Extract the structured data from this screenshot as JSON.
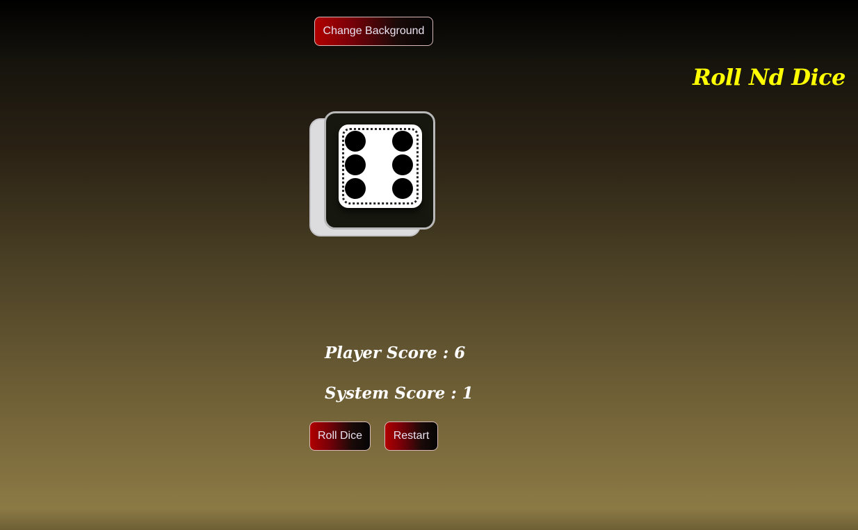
{
  "app": {
    "title": "Roll Nd Dice"
  },
  "controls": {
    "change_background_label": "Change Background",
    "roll_label": "Roll Dice",
    "restart_label": "Restart"
  },
  "dice": {
    "value": 6
  },
  "scores": {
    "player_label": "Player Score : 6",
    "system_label": "System Score : 1",
    "player": 6,
    "system": 1
  },
  "colors": {
    "title": "#ffff00",
    "button_accent": "#b00000",
    "score_text": "#ffffff"
  }
}
